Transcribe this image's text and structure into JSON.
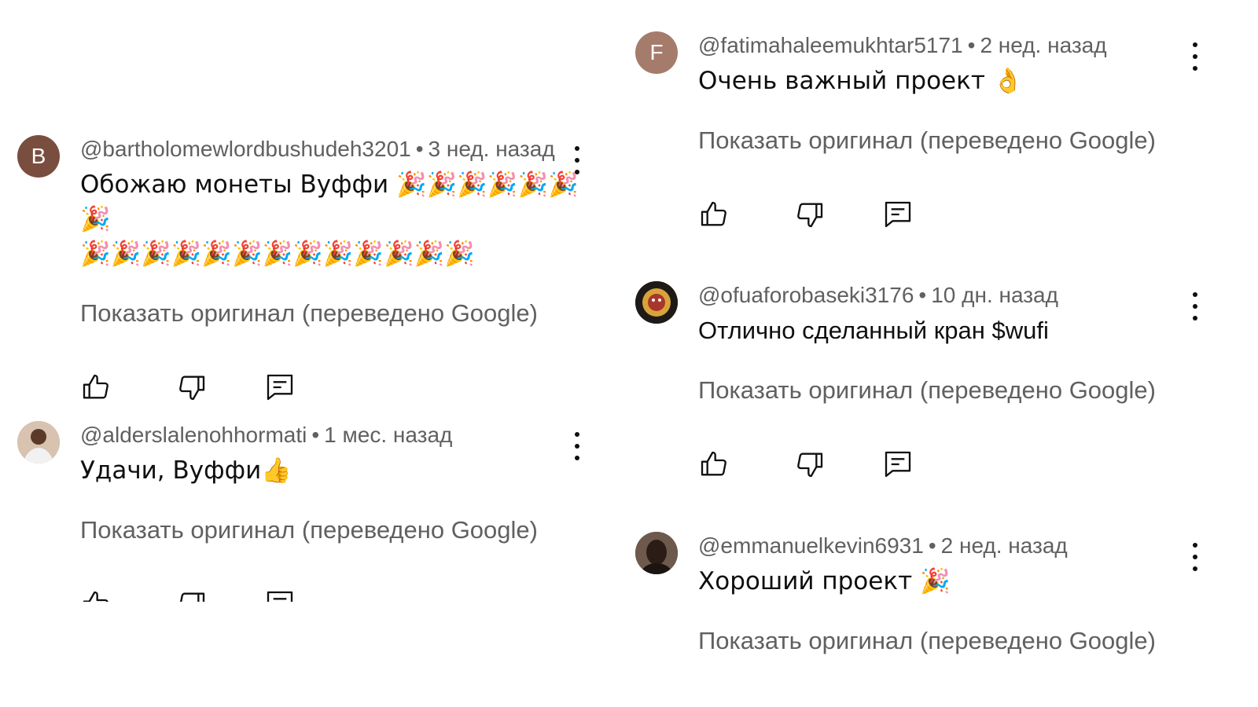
{
  "comments_left": [
    {
      "avatar_letter": "B",
      "avatar_color": "#7a4e3f",
      "author": "@bartholomewlordbushudeh3201",
      "time": "3 нед. назад",
      "text": "Обожаю монеты Вуффи 🎉🎉🎉🎉🎉🎉🎉",
      "text2": "🎉🎉🎉🎉🎉🎉🎉🎉🎉🎉🎉🎉🎉",
      "translate": "Показать оригинал (переведено Google)"
    },
    {
      "avatar_letter": "",
      "avatar_color": "#c9a48a",
      "author": "@alderslalenohhormati",
      "time": "1 мес. назад",
      "text": "Удачи, Вуффи👍",
      "translate": "Показать оригинал (переведено Google)"
    }
  ],
  "comments_right": [
    {
      "avatar_letter": "F",
      "avatar_color": "#a57c6c",
      "author": "@fatimahaleemukhtar5171",
      "time": "2 нед. назад",
      "text": "Очень важный проект 👌",
      "translate": "Показать оригинал (переведено Google)"
    },
    {
      "avatar_letter": "",
      "avatar_color": "#2a2220",
      "author": "@ofuaforobaseki3176",
      "time": "10 дн. назад",
      "text": "Отлично сделанный кран $wufi",
      "translate": "Показать оригинал (переведено Google)"
    },
    {
      "avatar_letter": "",
      "avatar_color": "#3a2c24",
      "author": "@emmanuelkevin6931",
      "time": "2 нед. назад",
      "text": "Хороший проект 🎉",
      "translate": "Показать оригинал (переведено Google)"
    }
  ],
  "meta_separator": "•",
  "icons": {
    "like": "thumb-up-icon",
    "dislike": "thumb-down-icon",
    "reply": "reply-icon",
    "menu": "more-vert-icon"
  }
}
